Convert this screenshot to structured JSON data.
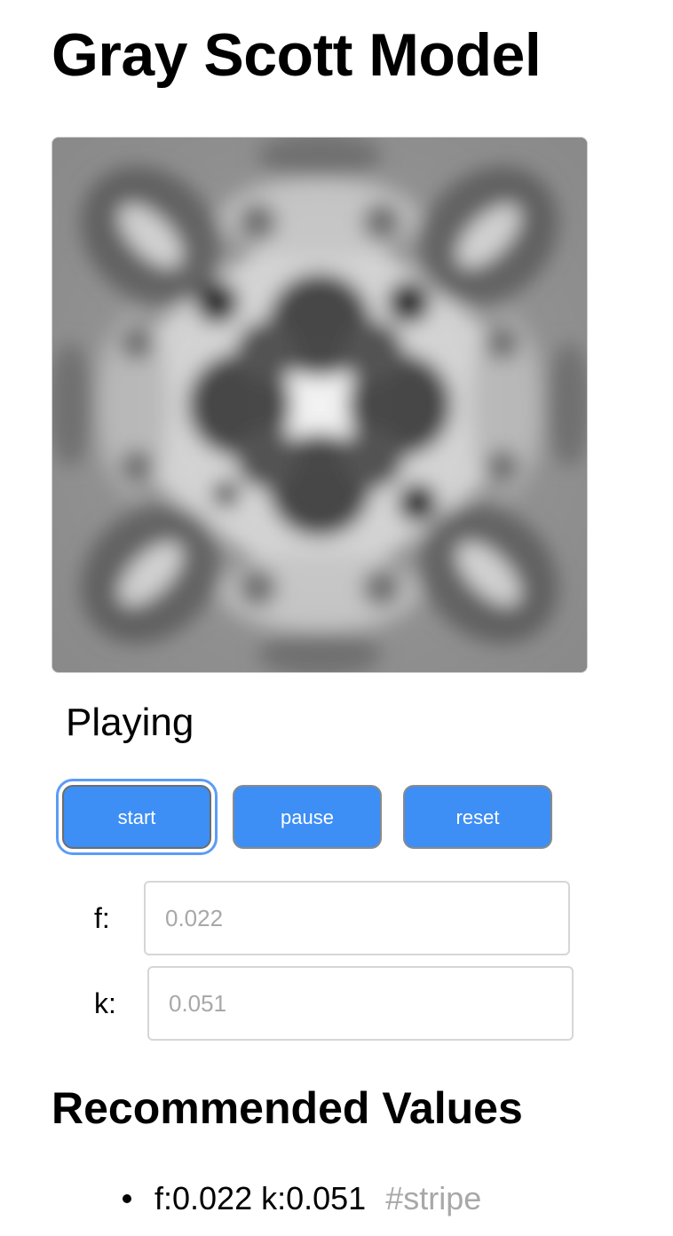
{
  "page": {
    "title": "Gray Scott Model",
    "status": "Playing"
  },
  "controls": {
    "start_label": "start",
    "pause_label": "pause",
    "reset_label": "reset",
    "accent_color": "#3d8ef5"
  },
  "params": {
    "f_label": "f:",
    "f_placeholder": "0.022",
    "k_label": "k:",
    "k_placeholder": "0.051"
  },
  "recommended": {
    "heading": "Recommended Values",
    "items": [
      {
        "values": "f:0.022 k:0.051",
        "tag": "#stripe"
      }
    ]
  }
}
